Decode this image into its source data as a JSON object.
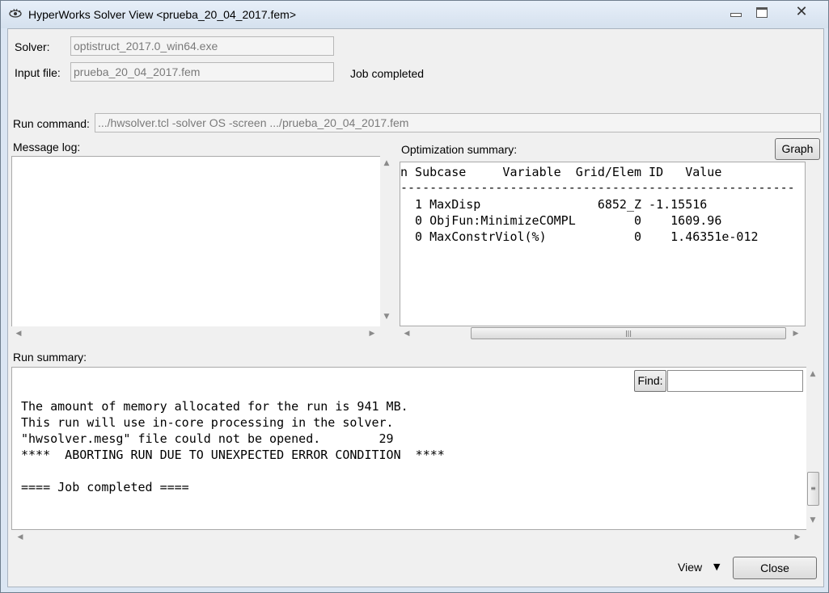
{
  "window": {
    "title": "HyperWorks Solver View <prueba_20_04_2017.fem>",
    "icon": "hyperworks-eye-icon",
    "close_glyph": "✕"
  },
  "solver": {
    "label": "Solver:",
    "value": "optistruct_2017.0_win64.exe"
  },
  "input_file": {
    "label": "Input file:",
    "value": "prueba_20_04_2017.fem"
  },
  "status": "Job completed",
  "run_command": {
    "label": "Run command:",
    "value": ".../hwsolver.tcl -solver OS -screen .../prueba_20_04_2017.fem"
  },
  "message_log": {
    "label": "Message log:"
  },
  "optimization_summary": {
    "label": "Optimization summary:",
    "graph_button": "Graph",
    "header": "n Subcase     Variable  Grid/Elem ID   Value",
    "separator": "------------------------------------------------------",
    "rows": [
      "  1 MaxDisp                6852_Z -1.15516",
      "  0 ObjFun:MinimizeCOMPL        0    1609.96",
      "  0 MaxConstrViol(%)            0    1.46351e-012"
    ]
  },
  "run_summary": {
    "label": "Run summary:",
    "find_label": "Find:",
    "find_value": "",
    "lines": [
      "The amount of memory allocated for the run is 941 MB.",
      "This run will use in-core processing in the solver.",
      "\"hwsolver.mesg\" file could not be opened.        29",
      "****  ABORTING RUN DUE TO UNEXPECTED ERROR CONDITION  ****",
      "",
      "==== Job completed ===="
    ]
  },
  "footer": {
    "view_label": "View",
    "close_button": "Close"
  }
}
